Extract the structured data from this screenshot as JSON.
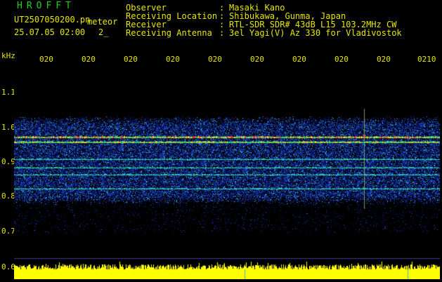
{
  "header": {
    "app_title": "HROFFT",
    "filename": "UT2507050200.pn",
    "event_label": "meteor",
    "datetime": "25.07.05 02:00",
    "count": "2_"
  },
  "station": [
    {
      "label": "Observer",
      "value": "Masaki Kano"
    },
    {
      "label": "Receiving Location",
      "value": "Shibukawa, Gunma, Japan"
    },
    {
      "label": "Receiver",
      "value": "RTL-SDR SDR# 43dB L15 103.2MHz CW"
    },
    {
      "label": "Receiving Antenna",
      "value": "3el Yagi(V) Az 330 for Vladivostok"
    }
  ],
  "separator": ":",
  "y_axis": {
    "unit": "kHz",
    "ticks": [
      "1.1",
      "1.0",
      "0.9",
      "0.8",
      "0.7",
      "0.6"
    ]
  },
  "x_axis": {
    "ticks": [
      "020",
      "020",
      "020",
      "020",
      "020",
      "020",
      "020",
      "020",
      "020",
      "0210"
    ]
  },
  "colors": {
    "background": "#000000",
    "text": "#e6e600",
    "title": "#22d022",
    "tick_mark": "#e6e600",
    "amplitude": "#ffff00",
    "grid_line": "#3a3aa0"
  },
  "spectrogram": {
    "freq_range_khz": [
      0.6,
      1.15
    ],
    "signal_bands_khz": [
      0.97,
      0.955,
      0.905,
      0.88,
      0.86,
      0.82
    ],
    "meteor_trace_position_min": 8.1
  }
}
